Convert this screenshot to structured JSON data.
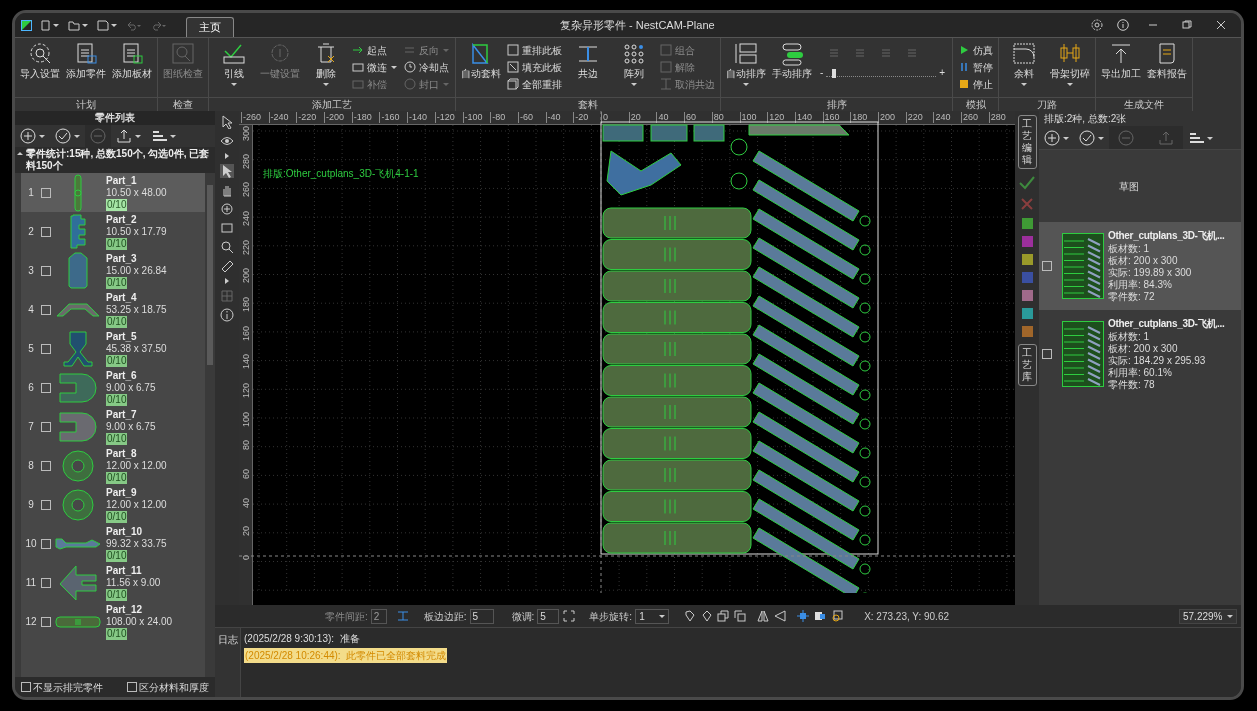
{
  "title_bar": {
    "tabs": [
      {
        "label": "主页",
        "selected": true
      }
    ],
    "title": "复杂异形零件 - NestCAM-Plane"
  },
  "ribbon": [
    {
      "label": "计划",
      "items": [
        {
          "kind": "large",
          "label": "导入设置",
          "disabled": false,
          "dropdown": false
        },
        {
          "kind": "large",
          "label": "添加零件",
          "disabled": false,
          "dropdown": false
        },
        {
          "kind": "large",
          "label": "添加板材",
          "disabled": false,
          "dropdown": false
        }
      ]
    },
    {
      "label": "检查",
      "items": [
        {
          "kind": "large",
          "label": "图纸检查",
          "disabled": true,
          "dropdown": false
        }
      ]
    },
    {
      "label": "添加工艺",
      "items": [
        {
          "kind": "large",
          "label": "引线",
          "disabled": false,
          "dropdown": true
        },
        {
          "kind": "large",
          "label": "一键设置",
          "disabled": true,
          "dropdown": false
        },
        {
          "kind": "large",
          "label": "删除",
          "disabled": false,
          "dropdown": true
        },
        {
          "kind": "small",
          "label": "起点",
          "disabled": false,
          "dropdown": false
        },
        {
          "kind": "small",
          "label": "微连",
          "disabled": false,
          "dropdown": true
        },
        {
          "kind": "small",
          "label": "补偿",
          "disabled": true,
          "dropdown": false
        },
        {
          "kind": "small",
          "label": "反向",
          "disabled": true,
          "dropdown": true
        },
        {
          "kind": "small",
          "label": "冷却点",
          "disabled": false,
          "dropdown": false
        },
        {
          "kind": "small",
          "label": "封口",
          "disabled": true,
          "dropdown": true
        }
      ]
    },
    {
      "label": "套料",
      "items": [
        {
          "kind": "large",
          "label": "自动套料",
          "disabled": false,
          "dropdown": false
        },
        {
          "kind": "small",
          "label": "重排此板",
          "disabled": false,
          "dropdown": false
        },
        {
          "kind": "small",
          "label": "填充此板",
          "disabled": false,
          "dropdown": false
        },
        {
          "kind": "small",
          "label": "全部重排",
          "disabled": false,
          "dropdown": false
        },
        {
          "kind": "large",
          "label": "共边",
          "disabled": false,
          "dropdown": false
        },
        {
          "kind": "large",
          "label": "阵列",
          "disabled": false,
          "dropdown": true
        },
        {
          "kind": "small",
          "label": "组合",
          "disabled": true,
          "dropdown": false
        },
        {
          "kind": "small",
          "label": "解除",
          "disabled": true,
          "dropdown": false
        },
        {
          "kind": "small",
          "label": "取消共边",
          "disabled": true,
          "dropdown": false
        }
      ]
    },
    {
      "label": "排序",
      "items": [
        {
          "kind": "large",
          "label": "自动排序",
          "disabled": false,
          "dropdown": true
        },
        {
          "kind": "large",
          "label": "手动排序",
          "disabled": false,
          "dropdown": false
        },
        {
          "kind": "slider",
          "level": 0.05,
          "min_label": "-",
          "max_label": "+",
          "tools_disabled": true
        }
      ]
    },
    {
      "label": "模拟",
      "items": [
        {
          "kind": "small",
          "label": "仿真",
          "disabled": false,
          "dropdown": false
        },
        {
          "kind": "small",
          "label": "暂停",
          "disabled": false,
          "dropdown": false
        },
        {
          "kind": "small",
          "label": "停止",
          "disabled": false,
          "dropdown": false
        }
      ]
    },
    {
      "label": "刀路",
      "items": [
        {
          "kind": "large",
          "label": "余料",
          "disabled": false,
          "dropdown": true
        },
        {
          "kind": "large",
          "label": "骨架切碎",
          "disabled": false,
          "dropdown": true
        }
      ]
    },
    {
      "label": "生成文件",
      "items": [
        {
          "kind": "large",
          "label": "导出加工",
          "disabled": false,
          "dropdown": false
        },
        {
          "kind": "large",
          "label": "套料报告",
          "disabled": false,
          "dropdown": false
        }
      ]
    }
  ],
  "parts_panel": {
    "title": "零件列表",
    "stats": "零件统计:15种, 总数150个, 勾选0件, 已套料150个",
    "parts": [
      {
        "index": "1",
        "name": "Part_1",
        "size": "10.50 x 48.00",
        "count": "0/10",
        "kind": "propeller",
        "selected": true,
        "checked": false
      },
      {
        "index": "2",
        "name": "Part_2",
        "size": "10.50 x 17.79",
        "count": "0/10",
        "kind": "bracket",
        "selected": false,
        "checked": false
      },
      {
        "index": "3",
        "name": "Part_3",
        "size": "15.00 x 26.84",
        "count": "0/10",
        "kind": "tag",
        "selected": false,
        "checked": false
      },
      {
        "index": "4",
        "name": "Part_4",
        "size": "53.25 x 18.75",
        "count": "0/10",
        "kind": "truss",
        "selected": false,
        "checked": false
      },
      {
        "index": "5",
        "name": "Part_5",
        "size": "45.38 x 37.50",
        "count": "0/10",
        "kind": "stand",
        "selected": false,
        "checked": false
      },
      {
        "index": "6",
        "name": "Part_6",
        "size": "9.00 x 6.75",
        "count": "0/10",
        "kind": "clip",
        "selected": false,
        "checked": false
      },
      {
        "index": "7",
        "name": "Part_7",
        "size": "9.00 x 6.75",
        "count": "0/10",
        "kind": "clip",
        "selected": false,
        "checked": false
      },
      {
        "index": "8",
        "name": "Part_8",
        "size": "12.00 x 12.00",
        "count": "0/10",
        "kind": "ring",
        "selected": false,
        "checked": false
      },
      {
        "index": "9",
        "name": "Part_9",
        "size": "12.00 x 12.00",
        "count": "0/10",
        "kind": "ring",
        "selected": false,
        "checked": false
      },
      {
        "index": "10",
        "name": "Part_10",
        "size": "99.32 x 33.75",
        "count": "0/10",
        "kind": "airplane",
        "selected": false,
        "checked": false
      },
      {
        "index": "11",
        "name": "Part_11",
        "size": "11.56 x 9.00",
        "count": "0/10",
        "kind": "arrow",
        "selected": false,
        "checked": false
      },
      {
        "index": "12",
        "name": "Part_12",
        "size": "108.00 x 24.00",
        "count": "0/10",
        "kind": "bar",
        "selected": false,
        "checked": false
      }
    ],
    "options": [
      {
        "label": "不显示排完零件",
        "checked": false
      },
      {
        "label": "区分材料和厚度",
        "checked": false
      }
    ]
  },
  "canvas": {
    "label": "排版:Other_cutplans_3D-飞机4-1-1",
    "top_ruler": [
      "-260",
      "-240",
      "-220",
      "-200",
      "-180",
      "-160",
      "-140",
      "-120",
      "-100",
      "-80",
      "-60",
      "-40",
      "-20",
      "0",
      "20",
      "40",
      "60",
      "80",
      "100",
      "120",
      "140",
      "160",
      "180",
      "200",
      "220",
      "240",
      "260",
      "280"
    ],
    "left_ruler": [
      "0",
      "20",
      "40",
      "60",
      "80",
      "100",
      "120",
      "140",
      "160",
      "180",
      "200",
      "220",
      "240",
      "260",
      "280",
      "300"
    ]
  },
  "process_strip": {
    "edit_label": "工艺编辑",
    "library_label": "工艺库",
    "layers": [
      {
        "color": "#3f9a35"
      },
      {
        "color": "#9c2f9c"
      },
      {
        "color": "#9a9a2a"
      },
      {
        "color": "#3a4fa0"
      },
      {
        "color": "#a06a8a"
      },
      {
        "color": "#2a9a9a"
      },
      {
        "color": "#a0662a"
      }
    ]
  },
  "sheets_panel": {
    "summary": "排版:2种, 总数:2张",
    "sketch_label": "草图",
    "sheets": [
      {
        "title": "Other_cutplans_3D-飞机...",
        "selected": true,
        "checked": false,
        "lines": [
          "板材数: 1",
          "板材: 200 x 300",
          "实际: 199.89 x 300",
          "利用率: 84.3%",
          "零件数: 72"
        ]
      },
      {
        "title": "Other_cutplans_3D-飞机...",
        "selected": false,
        "checked": false,
        "lines": [
          "板材数: 1",
          "板材: 200 x 300",
          "实际: 184.29 x 295.93",
          "利用率: 60.1%",
          "零件数: 78"
        ]
      }
    ]
  },
  "params_bar": {
    "part_gap": {
      "label": "零件间距:",
      "value": "2",
      "disabled": true
    },
    "edge_margin": {
      "label": "板边边距:",
      "value": "5"
    },
    "fine_tune": {
      "label": "微调:",
      "value": "5"
    },
    "rotation": {
      "label": "单步旋转:",
      "value": "1"
    },
    "coords": "X: 273.23, Y: 90.62",
    "zoom": "57.229%"
  },
  "log": {
    "tab": "日志",
    "entries": [
      {
        "text": "(2025/2/28 9:30:13):  准备",
        "kind": "info"
      },
      {
        "text": "(2025/2/28 10:26:44):  此零件已全部套料完成",
        "kind": "highlight"
      }
    ]
  }
}
